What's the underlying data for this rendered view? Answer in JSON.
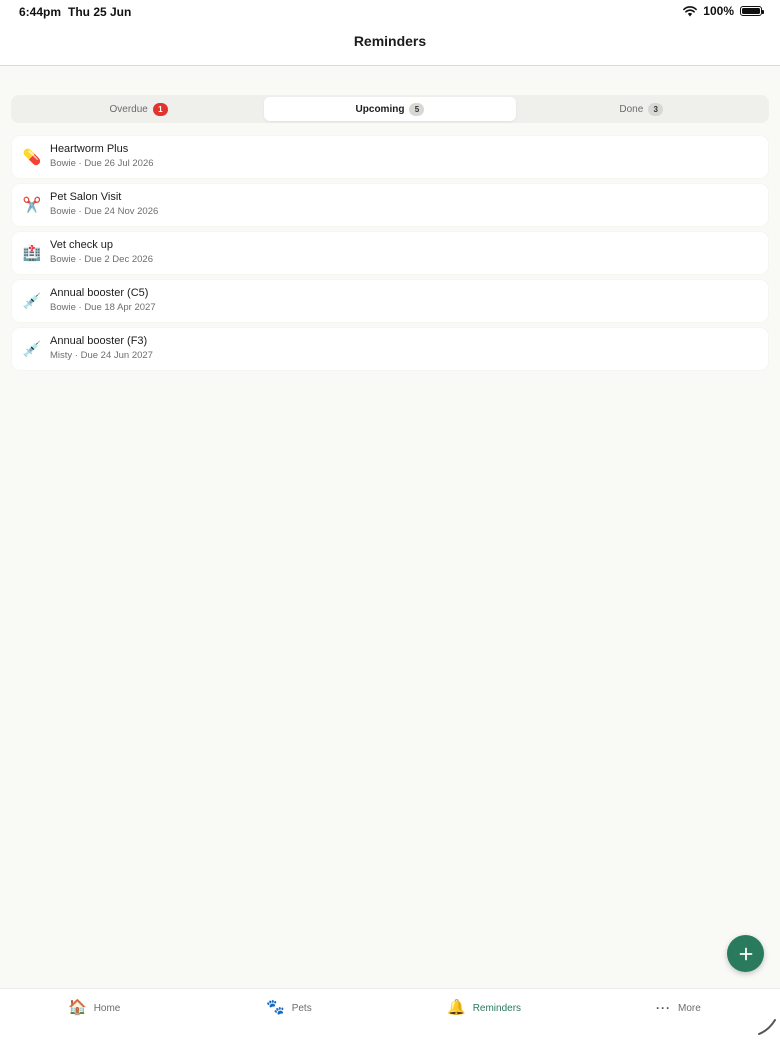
{
  "status_bar": {
    "time": "6:44pm",
    "date": "Thu 25 Jun",
    "battery": "100%"
  },
  "header": {
    "title": "Reminders"
  },
  "segments": [
    {
      "label": "Overdue",
      "count": "1",
      "active": false
    },
    {
      "label": "Upcoming",
      "count": "5",
      "active": true
    },
    {
      "label": "Done",
      "count": "3",
      "active": false
    }
  ],
  "reminders": [
    {
      "icon": "pill-icon",
      "glyph": "💊",
      "title": "Heartworm Plus",
      "subtitle": "Bowie · Due 26 Jul 2026"
    },
    {
      "icon": "scissors-icon",
      "glyph": "✂️",
      "title": "Pet Salon Visit",
      "subtitle": "Bowie · Due 24 Nov 2026"
    },
    {
      "icon": "hospital-icon",
      "glyph": "🏥",
      "title": "Vet check up",
      "subtitle": "Bowie · Due 2 Dec 2026"
    },
    {
      "icon": "syringe-icon",
      "glyph": "💉",
      "title": "Annual booster (C5)",
      "subtitle": "Bowie · Due 18 Apr 2027"
    },
    {
      "icon": "syringe-icon",
      "glyph": "💉",
      "title": "Annual booster (F3)",
      "subtitle": "Misty · Due 24 Jun 2027"
    }
  ],
  "tabs": [
    {
      "label": "Home",
      "icon": "house-icon",
      "glyph": "🏠",
      "active": false
    },
    {
      "label": "Pets",
      "icon": "paw-icon",
      "glyph": "🐾",
      "active": false
    },
    {
      "label": "Reminders",
      "icon": "bell-icon",
      "glyph": "🔔",
      "active": true
    },
    {
      "label": "More",
      "icon": "ellipsis-icon",
      "glyph": "···",
      "active": false
    }
  ],
  "colors": {
    "accent": "#2a7a5e",
    "alert": "#e0342f",
    "background": "#f9f9f6"
  }
}
